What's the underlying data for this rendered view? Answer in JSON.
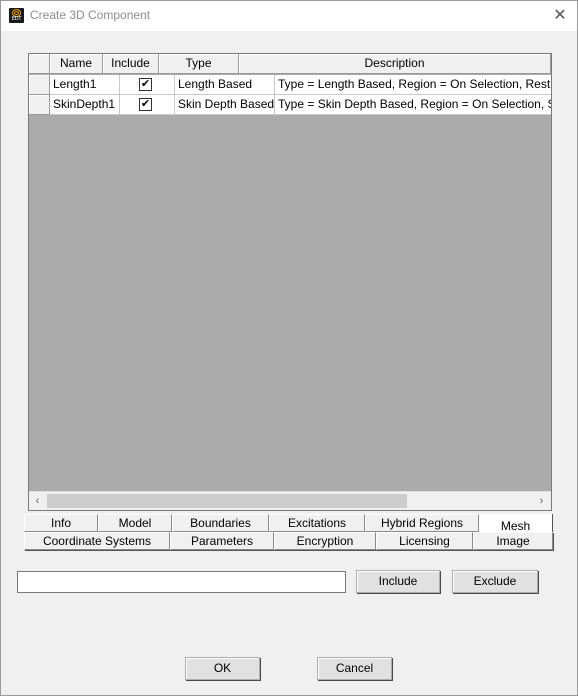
{
  "window": {
    "title": "Create 3D Component",
    "app_icon_label": "EDT",
    "close_glyph": "✕"
  },
  "grid": {
    "columns": [
      "Name",
      "Include",
      "Type",
      "Description"
    ],
    "rows": [
      {
        "name": "Length1",
        "include": true,
        "include_mark": "✔",
        "type": "Length Based",
        "description": "Type = Length Based, Region = On Selection, Restrict Length"
      },
      {
        "name": "SkinDepth1",
        "include": true,
        "include_mark": "✔",
        "type": "Skin Depth Based",
        "description": "Type = Skin Depth Based, Region = On Selection, Skin Depth"
      }
    ],
    "scroll_left_glyph": "‹",
    "scroll_right_glyph": "›"
  },
  "tabs": {
    "row1": [
      "Info",
      "Model",
      "Boundaries",
      "Excitations",
      "Hybrid Regions",
      "Mesh"
    ],
    "row2": [
      "Coordinate Systems",
      "Parameters",
      "Encryption",
      "Licensing",
      "Image"
    ],
    "active": "Mesh"
  },
  "filter": {
    "value": "",
    "include_label": "Include",
    "exclude_label": "Exclude"
  },
  "footer": {
    "ok_label": "OK",
    "cancel_label": "Cancel"
  }
}
